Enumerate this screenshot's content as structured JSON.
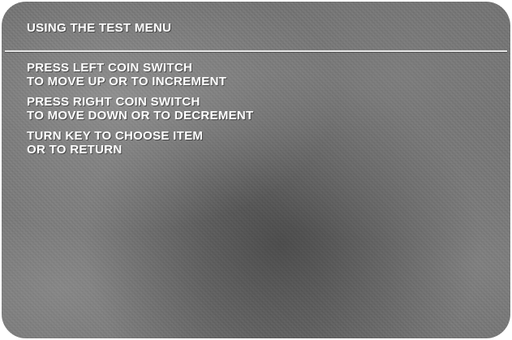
{
  "screen": {
    "title": "USING THE TEST MENU",
    "instructions": [
      {
        "line1": "PRESS LEFT COIN SWITCH",
        "line2": "TO MOVE UP OR TO INCREMENT"
      },
      {
        "line1": "PRESS RIGHT COIN SWITCH",
        "line2": "TO MOVE DOWN OR TO DECREMENT"
      },
      {
        "line1": "TURN KEY TO CHOOSE ITEM",
        "line2": "OR TO RETURN"
      }
    ]
  },
  "colors": {
    "text": "#ffffff",
    "screen_background": "#6c6c6c",
    "rule": "#e6e6e6"
  }
}
